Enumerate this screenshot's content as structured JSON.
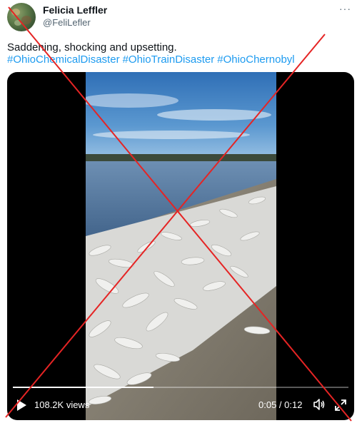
{
  "author": {
    "display_name": "Felicia Leffler",
    "handle": "@FeliLefler",
    "avatar_icon": "avatar-image"
  },
  "more_icon": "more-options-icon",
  "tweet": {
    "text": "Saddening, shocking and upsetting.",
    "hashtags": [
      "#OhioChemicalDisaster",
      "#OhioTrainDisaster",
      "#OhioChernobyl"
    ]
  },
  "video": {
    "views": "108.2K views",
    "time": "0:05 / 0:12",
    "progress": 0.42,
    "play_icon": "play-icon",
    "volume_icon": "volume-icon",
    "expand_icon": "expand-icon"
  },
  "overlay": {
    "type": "red-x-cross",
    "color": "#e52424"
  },
  "colors": {
    "link": "#1d9bf0",
    "text": "#0f1419",
    "secondary": "#536471"
  }
}
